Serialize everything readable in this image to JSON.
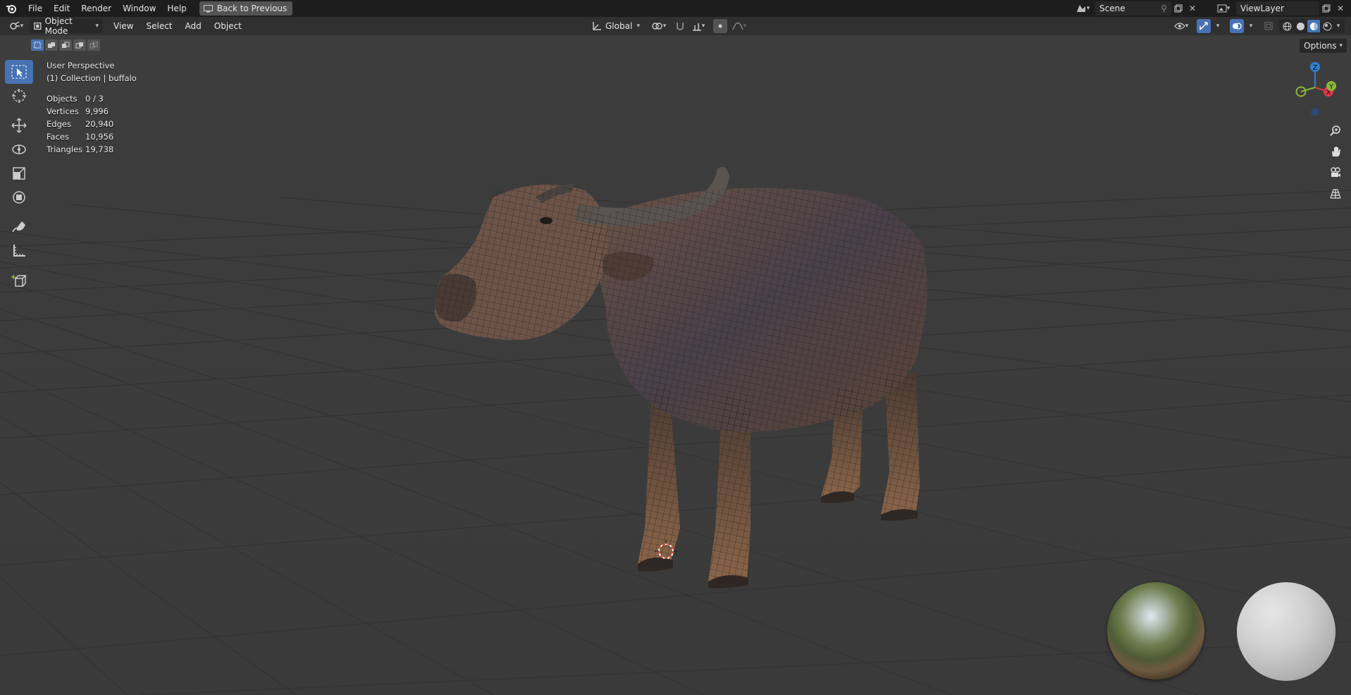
{
  "topbar": {
    "menus": [
      "File",
      "Edit",
      "Render",
      "Window",
      "Help"
    ],
    "back_label": "Back to Previous",
    "scene": "Scene",
    "view_layer": "ViewLayer"
  },
  "header": {
    "mode": "Object Mode",
    "menus": [
      "View",
      "Select",
      "Add",
      "Object"
    ],
    "orientation": "Global"
  },
  "viewport": {
    "perspective": "User Perspective",
    "collection": "(1) Collection | buffalo",
    "options_label": "Options",
    "stats": [
      {
        "label": "Objects",
        "value": "0 / 3"
      },
      {
        "label": "Vertices",
        "value": "9,996"
      },
      {
        "label": "Edges",
        "value": "20,940"
      },
      {
        "label": "Faces",
        "value": "10,956"
      },
      {
        "label": "Triangles",
        "value": "19,738"
      }
    ],
    "gizmo": {
      "x": "X",
      "y": "Y",
      "z": "Z"
    }
  },
  "tools": [
    "select-box-icon",
    "cursor-icon",
    "move-icon",
    "rotate-icon",
    "scale-icon",
    "transform-icon",
    "annotate-icon",
    "measure-icon",
    "add-cube-icon"
  ],
  "colors": {
    "accent": "#4772b3",
    "x_axis": "#e0364a",
    "y_axis": "#8bb836",
    "z_axis": "#2e80d6"
  }
}
